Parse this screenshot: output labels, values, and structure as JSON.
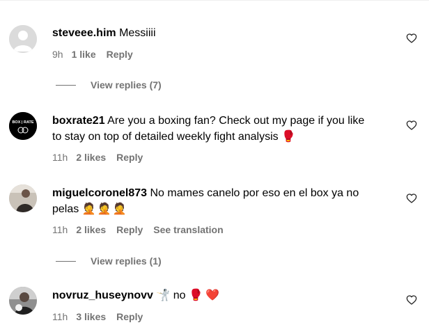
{
  "comments": [
    {
      "username": "steveee.him",
      "text": "Messiiii",
      "time": "9h",
      "likes": "1 like",
      "reply": "Reply",
      "view_replies": "View replies (7)"
    },
    {
      "username": "boxrate21",
      "text_line1": "Are you a boxing fan? Check out my page if you like",
      "text_line2": "to stay on top of detailed weekly fight analysis",
      "emoji": "🥊",
      "avatar_text": "BOX | RATE",
      "time": "11h",
      "likes": "2 likes",
      "reply": "Reply"
    },
    {
      "username": "miguelcoronel873",
      "text_line1": "No mames canelo por eso en el box ya no",
      "text_line2": "pelas",
      "emoji": "🤦🤦🤦",
      "time": "11h",
      "likes": "2 likes",
      "reply": "Reply",
      "see_translation": "See translation",
      "view_replies": "View replies (1)"
    },
    {
      "username": "novruz_huseynovv",
      "emoji_pre": "🤺",
      "text": "no",
      "emoji_post": "🥊 ❤️",
      "time": "11h",
      "likes": "3 likes",
      "reply": "Reply"
    }
  ],
  "icons": {
    "like": "heart-outline-icon",
    "avatar_default": "default-user-icon"
  },
  "colors": {
    "secondary_text": "#737373",
    "divider": "#efefef"
  }
}
